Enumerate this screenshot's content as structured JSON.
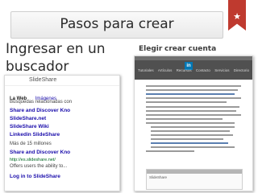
{
  "slide": {
    "title": "Pasos para crear",
    "heading": "Ingresar en un buscador",
    "step_elegir": "Elegir",
    "step_crear": "crear cuenta"
  },
  "search_panel": {
    "logo": "SlideShare",
    "tabs": {
      "web": "La Web",
      "other": "Imágenes"
    },
    "lines": [
      {
        "kind": "snip",
        "text": "Búsquedas relacionadas con"
      },
      {
        "kind": "link",
        "text": "Share and Discover Kno"
      },
      {
        "kind": "link",
        "text": "SlideShare.net"
      },
      {
        "kind": "link",
        "text": "SlideShare Wiki"
      },
      {
        "kind": "link",
        "text": "Linkedin SlideShare"
      },
      {
        "kind": "snip",
        "text": "Más de 15 millones"
      },
      {
        "kind": "link",
        "text": "Share and Discover Kno"
      },
      {
        "kind": "url",
        "text": "http://es.slideshare.net/"
      },
      {
        "kind": "snip",
        "text": "Offers users the ability to..."
      },
      {
        "kind": "link",
        "text": "Log in to SlideShare"
      }
    ]
  },
  "article_panel": {
    "logo": "in",
    "nav": [
      "Tutoriales",
      "Artículos",
      "Recursos",
      "Contacto",
      "Servicios",
      "Directorio"
    ],
    "embed_title": "SlideShare"
  },
  "colors": {
    "ribbon": "#bf3a2f",
    "linkedin": "#0077b5",
    "link": "#1a0dab",
    "url": "#006621"
  }
}
